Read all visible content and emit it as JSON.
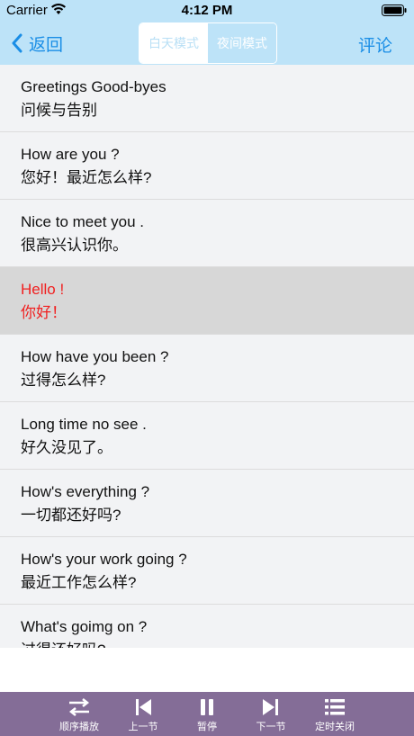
{
  "status_bar": {
    "carrier": "Carrier",
    "time": "4:12 PM"
  },
  "nav": {
    "back_label": "返回",
    "segments": {
      "day": "白天模式",
      "night": "夜间模式"
    },
    "comment_label": "评论"
  },
  "lessons": [
    {
      "en": "Greetings  Good-byes",
      "zh": "问候与告别"
    },
    {
      "en": "How are you ?",
      "zh": "您好！最近怎么样?"
    },
    {
      "en": "Nice to meet you .",
      "zh": "很高兴认识你。"
    },
    {
      "en": "Hello !",
      "zh": "你好！"
    },
    {
      "en": "How have you been ?",
      "zh": "过得怎么样?"
    },
    {
      "en": "Long time no see .",
      "zh": "好久没见了。"
    },
    {
      "en": "How's everything ?",
      "zh": "一切都还好吗?"
    },
    {
      "en": "How's your work going ?",
      "zh": "最近工作怎么样?"
    },
    {
      "en": "What's goimg on ?",
      "zh": "过得还好吗?"
    }
  ],
  "toolbar": {
    "order_play": "顺序播放",
    "prev": "上一节",
    "pause": "暂停",
    "next": "下一节",
    "timer_off": "定时关闭"
  },
  "colors": {
    "nav_bg": "#bde3f8",
    "accent_blue": "#1a8ee6",
    "highlight_red": "#f02020",
    "toolbar_bg": "#846d97"
  }
}
